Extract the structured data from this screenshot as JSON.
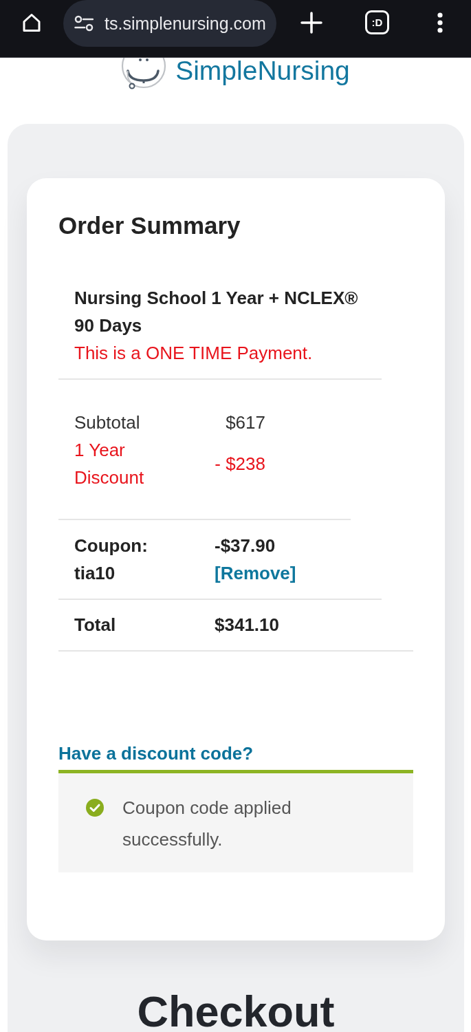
{
  "browser_bar": {
    "url": "ts.simplenursing.com",
    "tab_count": ":D"
  },
  "logo": {
    "text": "SimpleNursing"
  },
  "order_summary": {
    "title": "Order Summary",
    "product": {
      "name": "Nursing School 1 Year + NCLEX® 90 Days",
      "note": "This is a ONE TIME Payment."
    },
    "summary_rows": [
      {
        "label": "Subtotal",
        "value": "$617",
        "kind": "normal"
      },
      {
        "label": "1 Year Discount",
        "value": "- $238",
        "kind": "discount"
      }
    ],
    "coupon": {
      "label": "Coupon: tia10",
      "value": "-$37.90",
      "remove_link": "[Remove]"
    },
    "total": {
      "label": "Total",
      "value": "$341.10"
    },
    "discount_code": {
      "heading": "Have a discount code?",
      "message": {
        "kind": "success",
        "text": "Coupon code applied successfully."
      }
    }
  },
  "checkout": {
    "title": "Checkout"
  }
}
